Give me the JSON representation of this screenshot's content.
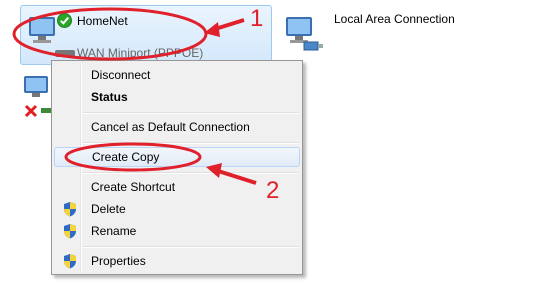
{
  "connections": [
    {
      "name": "HomeNet",
      "device": "WAN Miniport (PPPOE)",
      "selected": true,
      "status": "connected"
    },
    {
      "name": "Local Area Connection",
      "device": "",
      "selected": false
    },
    {
      "name": "",
      "device": "",
      "selected": false,
      "status": "disconnected"
    }
  ],
  "context_menu": {
    "items": [
      {
        "label": "Disconnect",
        "bold": false,
        "shield": false
      },
      {
        "label": "Status",
        "bold": true,
        "shield": false
      },
      {
        "label": "Cancel as Default Connection",
        "bold": false,
        "shield": false
      },
      {
        "label": "Create Copy",
        "bold": false,
        "shield": false,
        "highlighted": true
      },
      {
        "label": "Create Shortcut",
        "bold": false,
        "shield": false
      },
      {
        "label": "Delete",
        "bold": false,
        "shield": true
      },
      {
        "label": "Rename",
        "bold": false,
        "shield": true
      },
      {
        "label": "Properties",
        "bold": false,
        "shield": true
      }
    ]
  },
  "annotations": {
    "step1": "1",
    "step2": "2",
    "color": "#e0202b"
  },
  "colors": {
    "selection": "#d3e8fb",
    "menu_bg": "#f0f0f0",
    "check": "#2aa52a",
    "error_x": "#e02020"
  },
  "icons": [
    "network-monitor-icon",
    "check-badge-icon",
    "network-cable-icon",
    "error-x-icon",
    "uac-shield-icon"
  ]
}
